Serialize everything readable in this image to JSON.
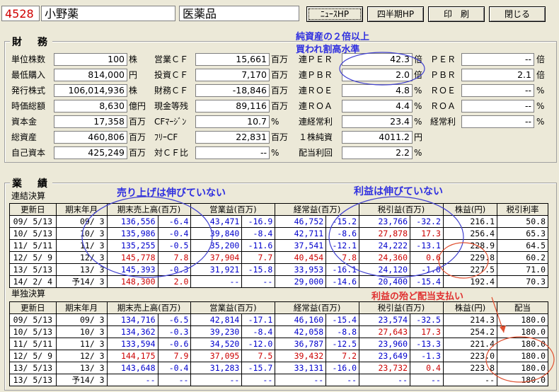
{
  "header": {
    "code": "4528",
    "name": "小野薬",
    "sector": "医薬品",
    "buttons": [
      "ﾆｭｰｽHP",
      "四半期HP",
      "印　刷",
      "閉じる"
    ]
  },
  "finance": {
    "title": "財　務",
    "col1": [
      {
        "label": "単位株数",
        "value": "100",
        "unit": "株"
      },
      {
        "label": "最低購入",
        "value": "814,000",
        "unit": "円"
      },
      {
        "label": "発行株式",
        "value": "106,014,936",
        "unit": "株"
      },
      {
        "label": "時価総額",
        "value": "8,630",
        "unit": "億円"
      },
      {
        "label": "資本金",
        "value": "17,358",
        "unit": "百万"
      },
      {
        "label": "総資産",
        "value": "460,806",
        "unit": "百万"
      },
      {
        "label": "自己資本",
        "value": "425,249",
        "unit": "百万"
      }
    ],
    "col2": [
      {
        "label": "営業ＣＦ",
        "value": "15,661",
        "unit": "百万"
      },
      {
        "label": "投資ＣＦ",
        "value": "7,170",
        "unit": "百万"
      },
      {
        "label": "財務ＣＦ",
        "value": "-18,846",
        "unit": "百万"
      },
      {
        "label": "現金等残",
        "value": "89,116",
        "unit": "百万"
      },
      {
        "label": "CFﾏｰｼﾞﾝ",
        "value": "10.7",
        "unit": "%"
      },
      {
        "label": "ﾌﾘｰCF",
        "value": "22,831",
        "unit": "百万"
      },
      {
        "label": "対ＣＦ比",
        "value": "--",
        "unit": "%"
      }
    ],
    "col3": [
      {
        "label": "連ＰＥＲ",
        "value": "42.3",
        "unit": "倍"
      },
      {
        "label": "連ＰＢＲ",
        "value": "2.0",
        "unit": "倍"
      },
      {
        "label": "連ＲＯＥ",
        "value": "4.8",
        "unit": "%"
      },
      {
        "label": "連ＲＯＡ",
        "value": "4.4",
        "unit": "%"
      },
      {
        "label": "連経常利",
        "value": "23.4",
        "unit": "%"
      },
      {
        "label": "１株純資",
        "value": "4011.2",
        "unit": "円"
      },
      {
        "label": "配当利回",
        "value": "2.2",
        "unit": "%"
      }
    ],
    "col4": [
      {
        "label": "ＰＥＲ",
        "value": "--",
        "unit": "倍"
      },
      {
        "label": "ＰＢＲ",
        "value": "2.1",
        "unit": "倍"
      },
      {
        "label": "ＲＯＥ",
        "value": "--",
        "unit": "%"
      },
      {
        "label": "ＲＯＡ",
        "value": "--",
        "unit": "%"
      },
      {
        "label": "経常利",
        "value": "--",
        "unit": "%"
      }
    ]
  },
  "notes": {
    "per_note_1": "純資産の２倍以上",
    "per_note_2": "買われ割高水準",
    "sales_note": "売り上げは伸びていない",
    "profit_note": "利益は伸びていない",
    "dividend_note": "利益の殆ど配当支払い"
  },
  "results": {
    "title": "業　績",
    "consolidated_label": "連結決算",
    "standalone_label": "単独決算",
    "cons_headers": [
      "更新日",
      "期末年月",
      "期末売上高(百万)",
      "営業益(百万)",
      "経常益(百万)",
      "税引益(百万)",
      "株益(円)",
      "税引利率"
    ],
    "cons_rows": [
      {
        "date": "09/ 5/13",
        "period": "09/ 3",
        "sales": "136,556",
        "sales_pct": "-6.4",
        "op": "43,471",
        "op_pct": "-16.9",
        "ord": "46,752",
        "ord_pct": "-15.2",
        "net": "23,766",
        "net_pct": "-32.2",
        "eps": "216.1",
        "extra": "50.8",
        "color": "blue"
      },
      {
        "date": "10/ 5/13",
        "period": "10/ 3",
        "sales": "135,986",
        "sales_pct": "-0.4",
        "op": "39,840",
        "op_pct": "-8.4",
        "ord": "42,711",
        "ord_pct": "-8.6",
        "net": "27,878",
        "net_pct": "17.3",
        "eps": "256.4",
        "extra": "65.3",
        "color": "blue",
        "net_color": "red"
      },
      {
        "date": "11/ 5/11",
        "period": "11/ 3",
        "sales": "135,255",
        "sales_pct": "-0.5",
        "op": "35,200",
        "op_pct": "-11.6",
        "ord": "37,541",
        "ord_pct": "-12.1",
        "net": "24,222",
        "net_pct": "-13.1",
        "eps": "228.9",
        "extra": "64.5",
        "color": "blue"
      },
      {
        "date": "12/ 5/ 9",
        "period": "12/ 3",
        "sales": "145,778",
        "sales_pct": "7.8",
        "op": "37,904",
        "op_pct": "7.7",
        "ord": "40,454",
        "ord_pct": "7.8",
        "net": "24,360",
        "net_pct": "0.6",
        "eps": "229.8",
        "extra": "60.2",
        "color": "red"
      },
      {
        "date": "13/ 5/13",
        "period": "13/ 3",
        "sales": "145,393",
        "sales_pct": "-0.3",
        "op": "31,921",
        "op_pct": "-15.8",
        "ord": "33,953",
        "ord_pct": "-16.1",
        "net": "24,120",
        "net_pct": "-1.0",
        "eps": "227.5",
        "extra": "71.0",
        "color": "blue"
      },
      {
        "date": "14/ 2/ 4",
        "period": "予14/ 3",
        "sales": "148,300",
        "sales_pct": "2.0",
        "op": "--",
        "op_pct": "--",
        "ord": "29,000",
        "ord_pct": "-14.6",
        "net": "20,400",
        "net_pct": "-15.4",
        "eps": "192.4",
        "extra": "70.3",
        "color": "mixed"
      }
    ],
    "std_headers": [
      "更新日",
      "期末年月",
      "期末売上高(百万)",
      "営業益(百万)",
      "経常益(百万)",
      "税引益(百万)",
      "株益(円)",
      "配当"
    ],
    "std_rows": [
      {
        "date": "09/ 5/13",
        "period": "09/ 3",
        "sales": "134,716",
        "sales_pct": "-6.5",
        "op": "42,814",
        "op_pct": "-17.1",
        "ord": "46,160",
        "ord_pct": "-15.4",
        "net": "23,574",
        "net_pct": "-32.5",
        "eps": "214.3",
        "extra": "180.0",
        "color": "blue"
      },
      {
        "date": "10/ 5/13",
        "period": "10/ 3",
        "sales": "134,362",
        "sales_pct": "-0.3",
        "op": "39,230",
        "op_pct": "-8.4",
        "ord": "42,058",
        "ord_pct": "-8.8",
        "net": "27,643",
        "net_pct": "17.3",
        "eps": "254.2",
        "extra": "180.0",
        "color": "blue",
        "net_color": "red"
      },
      {
        "date": "11/ 5/11",
        "period": "11/ 3",
        "sales": "133,594",
        "sales_pct": "-0.6",
        "op": "34,520",
        "op_pct": "-12.0",
        "ord": "36,787",
        "ord_pct": "-12.5",
        "net": "23,960",
        "net_pct": "-13.3",
        "eps": "221.4",
        "extra": "180.0",
        "color": "blue"
      },
      {
        "date": "12/ 5/ 9",
        "period": "12/ 3",
        "sales": "144,175",
        "sales_pct": "7.9",
        "op": "37,095",
        "op_pct": "7.5",
        "ord": "39,432",
        "ord_pct": "7.2",
        "net": "23,649",
        "net_pct": "-1.3",
        "eps": "223.0",
        "extra": "180.0",
        "color": "red",
        "net_color": "blue"
      },
      {
        "date": "13/ 5/13",
        "period": "13/ 3",
        "sales": "143,648",
        "sales_pct": "-0.4",
        "op": "31,283",
        "op_pct": "-15.7",
        "ord": "33,131",
        "ord_pct": "-16.0",
        "net": "23,732",
        "net_pct": "0.4",
        "eps": "223.8",
        "extra": "180.0",
        "color": "blue",
        "net_color": "red"
      },
      {
        "date": "13/ 5/13",
        "period": "予14/ 3",
        "sales": "--",
        "sales_pct": "--",
        "op": "--",
        "op_pct": "--",
        "ord": "--",
        "ord_pct": "--",
        "net": "--",
        "net_pct": "--",
        "eps": "--",
        "extra": "180.0",
        "color": "blue"
      }
    ]
  },
  "colors": {
    "blue": "#0000cc",
    "red": "#cc0000",
    "annot_blue": "#3030e0",
    "annot_red": "#e03030",
    "ellipse_blue": "#4040d0",
    "ellipse_red": "#e05030"
  }
}
